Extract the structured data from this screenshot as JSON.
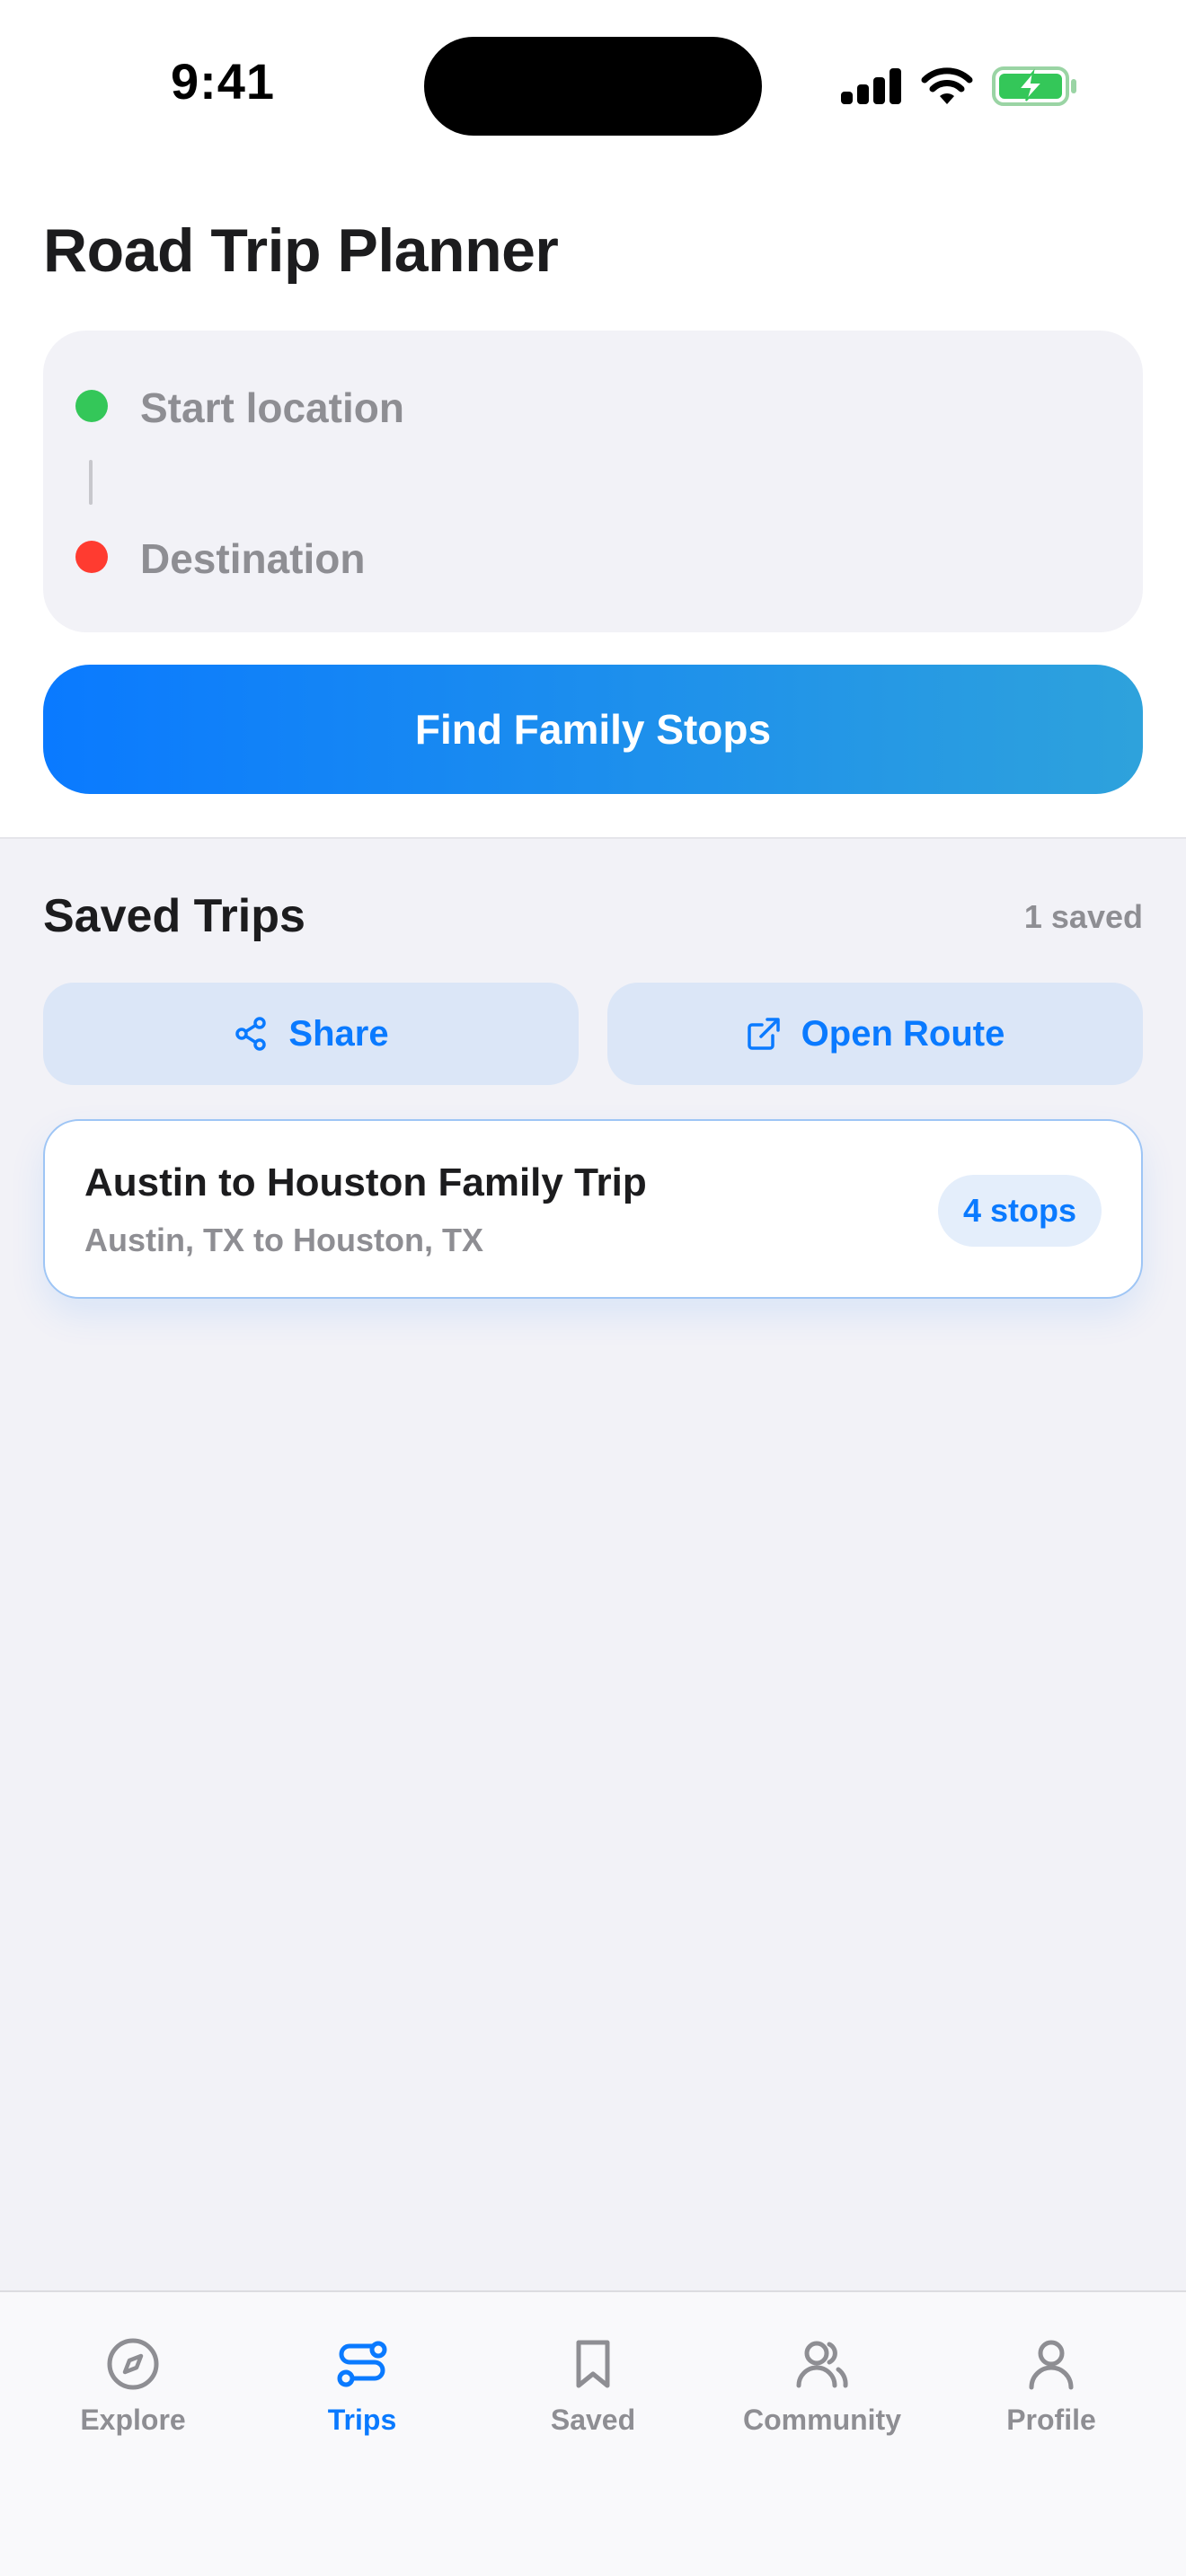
{
  "status_bar": {
    "time": "9:41"
  },
  "header": {
    "title": "Road Trip Planner"
  },
  "route": {
    "start_placeholder": "Start location",
    "destination_placeholder": "Destination",
    "start_value": "",
    "destination_value": ""
  },
  "find_button": {
    "label": "Find Family Stops"
  },
  "saved_trips": {
    "title": "Saved Trips",
    "count_label": "1 saved",
    "share_label": "Share",
    "open_route_label": "Open Route",
    "trips": [
      {
        "title": "Austin to Houston Family Trip",
        "subtitle": "Austin, TX to Houston, TX",
        "stops_label": "4 stops"
      }
    ]
  },
  "tabbar": {
    "tabs": [
      {
        "label": "Explore",
        "icon": "compass-icon",
        "active": false
      },
      {
        "label": "Trips",
        "icon": "route-icon",
        "active": true
      },
      {
        "label": "Saved",
        "icon": "bookmark-icon",
        "active": false
      },
      {
        "label": "Community",
        "icon": "users-icon",
        "active": false
      },
      {
        "label": "Profile",
        "icon": "person-icon",
        "active": false
      }
    ]
  },
  "colors": {
    "accent": "#0a7aff",
    "gradient_end": "#2ea2dc",
    "start_dot": "#34c759",
    "destination_dot": "#ff3b30",
    "inactive": "#8e8e93",
    "background": "#f2f2f7"
  }
}
